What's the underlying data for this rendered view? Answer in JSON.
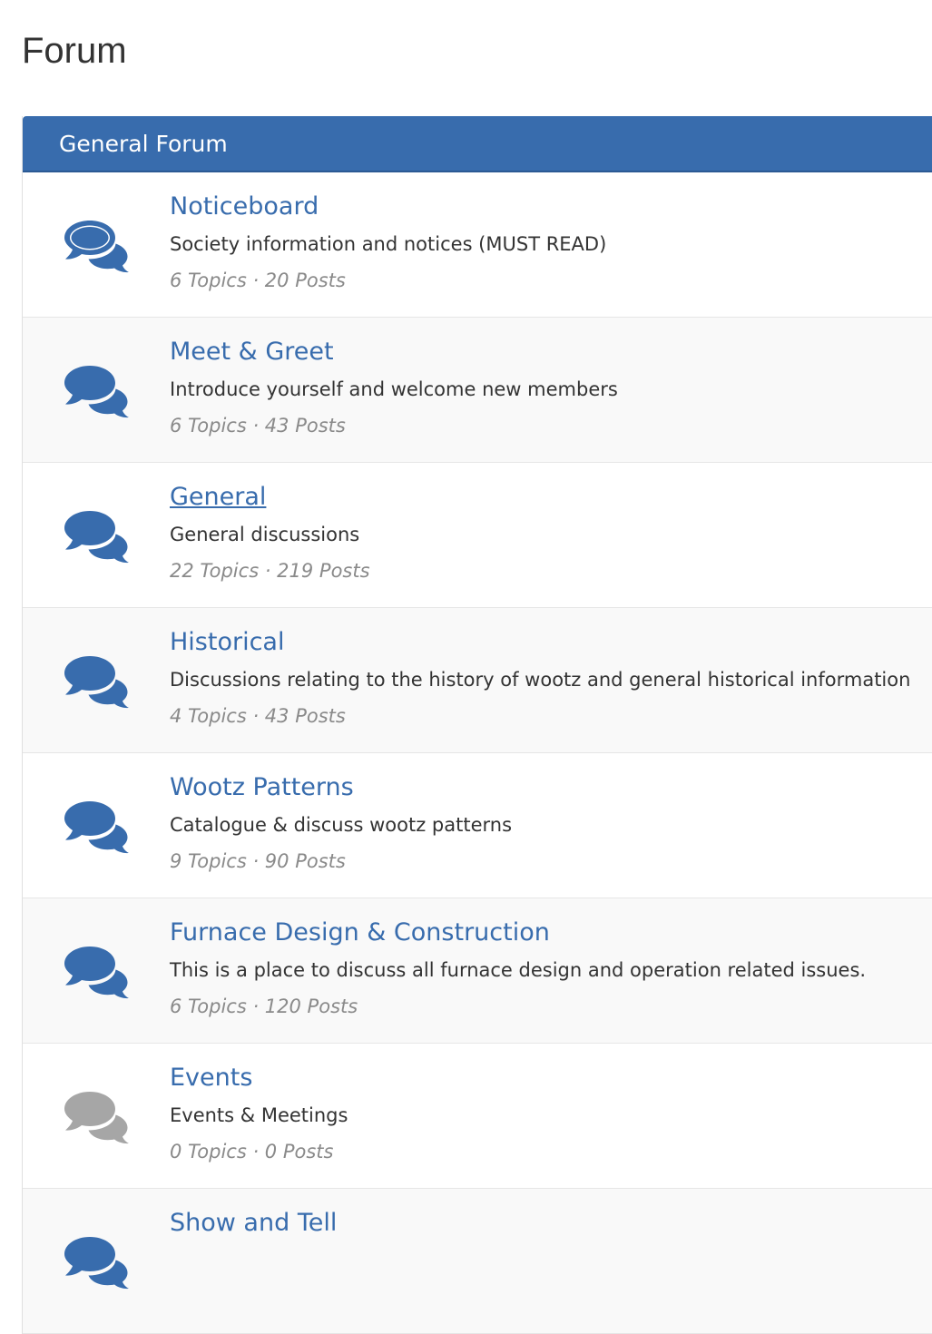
{
  "page": {
    "title": "Forum"
  },
  "section": {
    "title": "General Forum"
  },
  "colors": {
    "accent": "#386cad",
    "inactive_icon": "#a6a6a6"
  },
  "forums": [
    {
      "name": "Noticeboard",
      "description": "Society information and notices (MUST READ)",
      "stats": "6 Topics · 20 Posts",
      "icon": "comments-icon",
      "active": true
    },
    {
      "name": "Meet & Greet",
      "description": "Introduce yourself and welcome new members",
      "stats": "6 Topics · 43 Posts",
      "icon": "comments-icon",
      "active": true
    },
    {
      "name": "General",
      "description": "General discussions",
      "stats": "22 Topics · 219 Posts",
      "icon": "comments-icon",
      "active": true
    },
    {
      "name": "Historical",
      "description": "Discussions relating to the history of wootz and general historical information",
      "stats": "4 Topics · 43 Posts",
      "icon": "comments-icon",
      "active": true
    },
    {
      "name": "Wootz Patterns",
      "description": "Catalogue & discuss wootz patterns",
      "stats": "9 Topics · 90 Posts",
      "icon": "comments-icon",
      "active": true
    },
    {
      "name": "Furnace Design & Construction",
      "description": "This is a place to discuss all furnace design and operation related issues.",
      "stats": "6 Topics · 120 Posts",
      "icon": "comments-icon",
      "active": true
    },
    {
      "name": "Events",
      "description": "Events & Meetings",
      "stats": "0 Topics · 0 Posts",
      "icon": "comments-icon",
      "active": false
    },
    {
      "name": "Show and Tell",
      "description": "",
      "stats": "",
      "icon": "comments-icon",
      "active": true
    }
  ]
}
